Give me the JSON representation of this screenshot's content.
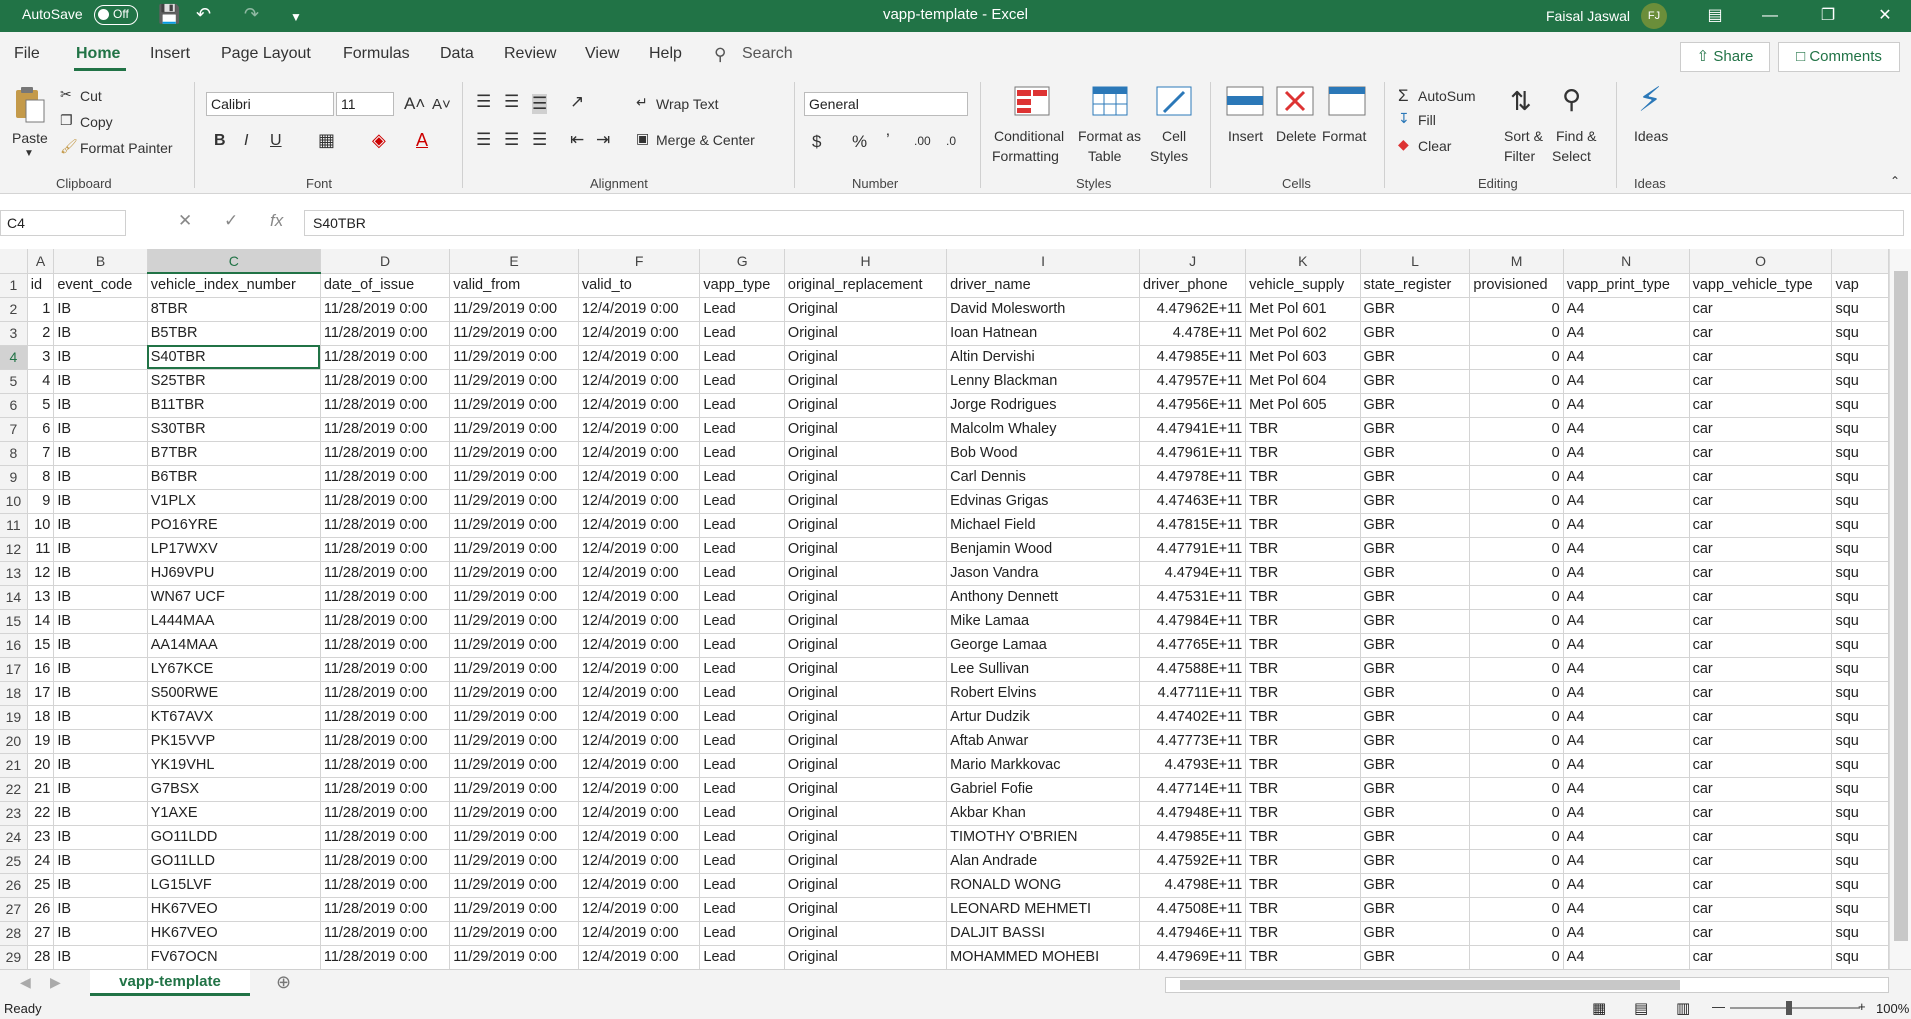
{
  "titlebar": {
    "autosave": "AutoSave",
    "autosave_state": "Off",
    "doc_title": "vapp-template  -  Excel",
    "user_name": "Faisal Jaswal",
    "user_initials": "FJ"
  },
  "tabs": [
    "File",
    "Home",
    "Insert",
    "Page Layout",
    "Formulas",
    "Data",
    "Review",
    "View",
    "Help"
  ],
  "search_label": "Search",
  "share_label": "Share",
  "comments_label": "Comments",
  "ribbon": {
    "clipboard": {
      "paste": "Paste",
      "cut": "Cut",
      "copy": "Copy",
      "format_painter": "Format Painter",
      "label": "Clipboard"
    },
    "font": {
      "name": "Calibri",
      "size": "11",
      "label": "Font"
    },
    "alignment": {
      "wrap": "Wrap Text",
      "merge": "Merge & Center",
      "label": "Alignment"
    },
    "number": {
      "format": "General",
      "label": "Number"
    },
    "styles": {
      "conditional": "Conditional",
      "formatting": "Formatting",
      "format_as": "Format as",
      "table": "Table",
      "cell": "Cell",
      "cell_styles": "Styles",
      "label": "Styles"
    },
    "cells": {
      "insert": "Insert",
      "delete": "Delete",
      "format": "Format",
      "label": "Cells"
    },
    "editing": {
      "autosum": "AutoSum",
      "fill": "Fill",
      "clear": "Clear",
      "sort": "Sort &",
      "filter": "Filter",
      "find": "Find &",
      "select": "Select",
      "label": "Editing"
    },
    "ideas": {
      "ideas": "Ideas",
      "label": "Ideas"
    }
  },
  "formula_bar": {
    "name_box": "C4",
    "content": "S40TBR"
  },
  "columns": [
    "A",
    "B",
    "C",
    "D",
    "E",
    "F",
    "G",
    "H",
    "I",
    "J",
    "K",
    "L",
    "M",
    "N",
    "O"
  ],
  "headers": [
    "id",
    "event_code",
    "vehicle_index_number",
    "date_of_issue",
    "valid_from",
    "valid_to",
    "vapp_type",
    "original_replacement",
    "driver_name",
    "driver_phone",
    "vehicle_supply",
    "state_register",
    "provisioned",
    "vapp_print_type",
    "vapp_vehicle_type"
  ],
  "extra_header": "vap",
  "extra_cell": "squ",
  "rows": [
    [
      "1",
      "IB",
      "8TBR",
      "11/28/2019 0:00",
      "11/29/2019 0:00",
      "12/4/2019 0:00",
      "Lead",
      "Original",
      "David Molesworth",
      "4.47962E+11",
      "Met Pol 601",
      "GBR",
      "0",
      "A4",
      "car"
    ],
    [
      "2",
      "IB",
      "B5TBR",
      "11/28/2019 0:00",
      "11/29/2019 0:00",
      "12/4/2019 0:00",
      "Lead",
      "Original",
      "Ioan Hatnean",
      "4.478E+11",
      "Met Pol 602",
      "GBR",
      "0",
      "A4",
      "car"
    ],
    [
      "3",
      "IB",
      "S40TBR",
      "11/28/2019 0:00",
      "11/29/2019 0:00",
      "12/4/2019 0:00",
      "Lead",
      "Original",
      "Altin Dervishi",
      "4.47985E+11",
      "Met Pol 603",
      "GBR",
      "0",
      "A4",
      "car"
    ],
    [
      "4",
      "IB",
      "S25TBR",
      "11/28/2019 0:00",
      "11/29/2019 0:00",
      "12/4/2019 0:00",
      "Lead",
      "Original",
      "Lenny Blackman",
      "4.47957E+11",
      "Met Pol 604",
      "GBR",
      "0",
      "A4",
      "car"
    ],
    [
      "5",
      "IB",
      "B11TBR",
      "11/28/2019 0:00",
      "11/29/2019 0:00",
      "12/4/2019 0:00",
      "Lead",
      "Original",
      "Jorge Rodrigues",
      "4.47956E+11",
      "Met Pol 605",
      "GBR",
      "0",
      "A4",
      "car"
    ],
    [
      "6",
      "IB",
      "S30TBR",
      "11/28/2019 0:00",
      "11/29/2019 0:00",
      "12/4/2019 0:00",
      "Lead",
      "Original",
      "Malcolm Whaley",
      "4.47941E+11",
      "TBR",
      "GBR",
      "0",
      "A4",
      "car"
    ],
    [
      "7",
      "IB",
      "B7TBR",
      "11/28/2019 0:00",
      "11/29/2019 0:00",
      "12/4/2019 0:00",
      "Lead",
      "Original",
      "Bob Wood",
      "4.47961E+11",
      "TBR",
      "GBR",
      "0",
      "A4",
      "car"
    ],
    [
      "8",
      "IB",
      "B6TBR",
      "11/28/2019 0:00",
      "11/29/2019 0:00",
      "12/4/2019 0:00",
      "Lead",
      "Original",
      "Carl  Dennis",
      "4.47978E+11",
      "TBR",
      "GBR",
      "0",
      "A4",
      "car"
    ],
    [
      "9",
      "IB",
      "V1PLX",
      "11/28/2019 0:00",
      "11/29/2019 0:00",
      "12/4/2019 0:00",
      "Lead",
      "Original",
      "Edvinas  Grigas",
      "4.47463E+11",
      "TBR",
      "GBR",
      "0",
      "A4",
      "car"
    ],
    [
      "10",
      "IB",
      "PO16YRE",
      "11/28/2019 0:00",
      "11/29/2019 0:00",
      "12/4/2019 0:00",
      "Lead",
      "Original",
      "Michael Field",
      "4.47815E+11",
      "TBR",
      "GBR",
      "0",
      "A4",
      "car"
    ],
    [
      "11",
      "IB",
      "LP17WXV",
      "11/28/2019 0:00",
      "11/29/2019 0:00",
      "12/4/2019 0:00",
      "Lead",
      "Original",
      "Benjamin Wood",
      "4.47791E+11",
      "TBR",
      "GBR",
      "0",
      "A4",
      "car"
    ],
    [
      "12",
      "IB",
      "HJ69VPU",
      "11/28/2019 0:00",
      "11/29/2019 0:00",
      "12/4/2019 0:00",
      "Lead",
      "Original",
      "Jason Vandra",
      "4.4794E+11",
      "TBR",
      "GBR",
      "0",
      "A4",
      "car"
    ],
    [
      "13",
      "IB",
      "WN67 UCF",
      "11/28/2019 0:00",
      "11/29/2019 0:00",
      "12/4/2019 0:00",
      "Lead",
      "Original",
      "Anthony  Dennett",
      "4.47531E+11",
      "TBR",
      "GBR",
      "0",
      "A4",
      "car"
    ],
    [
      "14",
      "IB",
      "L444MAA",
      "11/28/2019 0:00",
      "11/29/2019 0:00",
      "12/4/2019 0:00",
      "Lead",
      "Original",
      "Mike  Lamaa",
      "4.47984E+11",
      "TBR",
      "GBR",
      "0",
      "A4",
      "car"
    ],
    [
      "15",
      "IB",
      "AA14MAA",
      "11/28/2019 0:00",
      "11/29/2019 0:00",
      "12/4/2019 0:00",
      "Lead",
      "Original",
      "George  Lamaa",
      "4.47765E+11",
      "TBR",
      "GBR",
      "0",
      "A4",
      "car"
    ],
    [
      "16",
      "IB",
      "LY67KCE",
      "11/28/2019 0:00",
      "11/29/2019 0:00",
      "12/4/2019 0:00",
      "Lead",
      "Original",
      "Lee Sullivan",
      "4.47588E+11",
      "TBR",
      "GBR",
      "0",
      "A4",
      "car"
    ],
    [
      "17",
      "IB",
      "S500RWE",
      "11/28/2019 0:00",
      "11/29/2019 0:00",
      "12/4/2019 0:00",
      "Lead",
      "Original",
      "Robert Elvins",
      "4.47711E+11",
      "TBR",
      "GBR",
      "0",
      "A4",
      "car"
    ],
    [
      "18",
      "IB",
      "KT67AVX",
      "11/28/2019 0:00",
      "11/29/2019 0:00",
      "12/4/2019 0:00",
      "Lead",
      "Original",
      "Artur  Dudzik",
      "4.47402E+11",
      "TBR",
      "GBR",
      "0",
      "A4",
      "car"
    ],
    [
      "19",
      "IB",
      "PK15VVP",
      "11/28/2019 0:00",
      "11/29/2019 0:00",
      "12/4/2019 0:00",
      "Lead",
      "Original",
      "Aftab Anwar",
      "4.47773E+11",
      "TBR",
      "GBR",
      "0",
      "A4",
      "car"
    ],
    [
      "20",
      "IB",
      "YK19VHL",
      "11/28/2019 0:00",
      "11/29/2019 0:00",
      "12/4/2019 0:00",
      "Lead",
      "Original",
      "Mario  Markkovac",
      "4.4793E+11",
      "TBR",
      "GBR",
      "0",
      "A4",
      "car"
    ],
    [
      "21",
      "IB",
      "G7BSX",
      "11/28/2019 0:00",
      "11/29/2019 0:00",
      "12/4/2019 0:00",
      "Lead",
      "Original",
      "Gabriel Fofie",
      "4.47714E+11",
      "TBR",
      "GBR",
      "0",
      "A4",
      "car"
    ],
    [
      "22",
      "IB",
      "Y1AXE",
      "11/28/2019 0:00",
      "11/29/2019 0:00",
      "12/4/2019 0:00",
      "Lead",
      "Original",
      "Akbar Khan",
      "4.47948E+11",
      "TBR",
      "GBR",
      "0",
      "A4",
      "car"
    ],
    [
      "23",
      "IB",
      "GO11LDD",
      "11/28/2019 0:00",
      "11/29/2019 0:00",
      "12/4/2019 0:00",
      "Lead",
      "Original",
      "TIMOTHY  O'BRIEN",
      "4.47985E+11",
      "TBR",
      "GBR",
      "0",
      "A4",
      "car"
    ],
    [
      "24",
      "IB",
      "GO11LLD",
      "11/28/2019 0:00",
      "11/29/2019 0:00",
      "12/4/2019 0:00",
      "Lead",
      "Original",
      "Alan Andrade",
      "4.47592E+11",
      "TBR",
      "GBR",
      "0",
      "A4",
      "car"
    ],
    [
      "25",
      "IB",
      "LG15LVF",
      "11/28/2019 0:00",
      "11/29/2019 0:00",
      "12/4/2019 0:00",
      "Lead",
      "Original",
      "RONALD WONG",
      "4.4798E+11",
      "TBR",
      "GBR",
      "0",
      "A4",
      "car"
    ],
    [
      "26",
      "IB",
      "HK67VEO",
      "11/28/2019 0:00",
      "11/29/2019 0:00",
      "12/4/2019 0:00",
      "Lead",
      "Original",
      "LEONARD MEHMETI",
      "4.47508E+11",
      "TBR",
      "GBR",
      "0",
      "A4",
      "car"
    ],
    [
      "27",
      "IB",
      "HK67VEO",
      "11/28/2019 0:00",
      "11/29/2019 0:00",
      "12/4/2019 0:00",
      "Lead",
      "Original",
      "DALJIT BASSI",
      "4.47946E+11",
      "TBR",
      "GBR",
      "0",
      "A4",
      "car"
    ],
    [
      "28",
      "IB",
      "FV67OCN",
      "11/28/2019 0:00",
      "11/29/2019 0:00",
      "12/4/2019 0:00",
      "Lead",
      "Original",
      "MOHAMMED MOHEBI",
      "4.47969E+11",
      "TBR",
      "GBR",
      "0",
      "A4",
      "car"
    ]
  ],
  "sheet_tab": "vapp-template",
  "status": {
    "ready": "Ready",
    "zoom": "100%"
  },
  "colors": {
    "accent": "#217346"
  }
}
